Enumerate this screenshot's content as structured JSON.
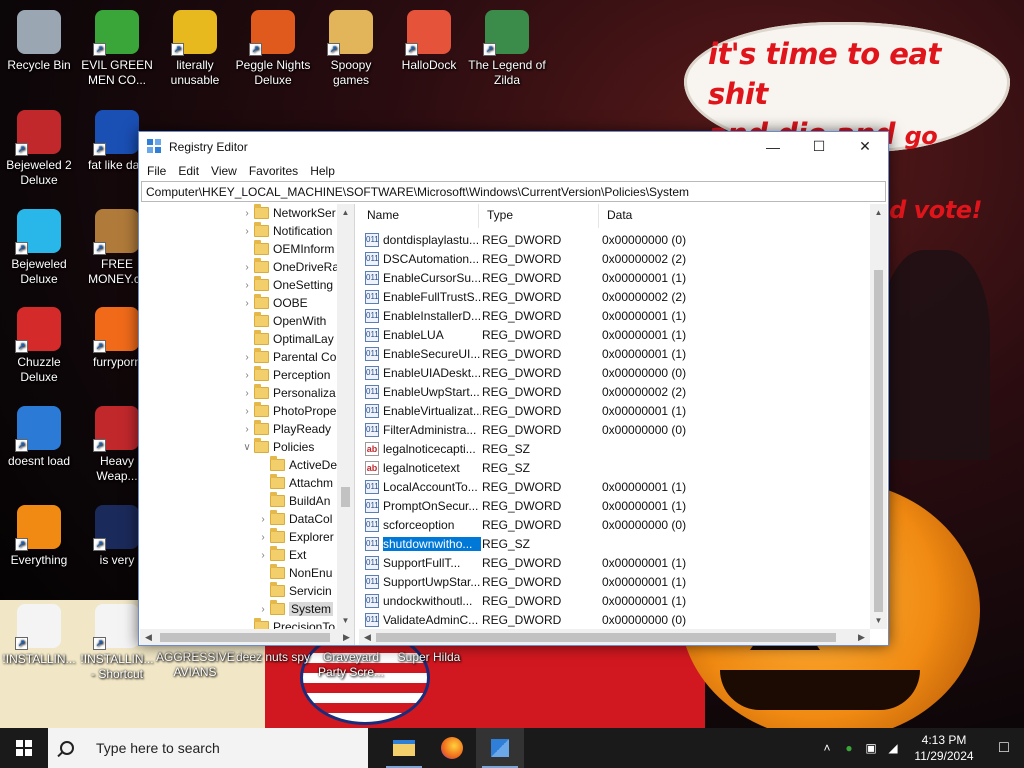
{
  "wallpaper": {
    "speech_line1": "it's time to eat shit",
    "speech_line2a": "and die and",
    "speech_line2b": "go trick",
    "speech_line3": "or treating and vote!"
  },
  "desktop_icons": [
    {
      "label": "Recycle Bin",
      "icon": "recycle-bin-icon",
      "color": "#9aa6b2"
    },
    {
      "label": "EVIL GREEN MEN CO...",
      "icon": "green-people-icon",
      "color": "#3aa63a"
    },
    {
      "label": "literally unusable",
      "icon": "chrome-icon",
      "color": "#e8b81f"
    },
    {
      "label": "Peggle Nights Deluxe",
      "icon": "peggle-icon",
      "color": "#e05a1e"
    },
    {
      "label": "Spoopy games",
      "icon": "folder-icon",
      "color": "#e2b55a"
    },
    {
      "label": "HalloDock",
      "icon": "windows-logo-icon",
      "color": "#e5533a"
    },
    {
      "label": "The Legend of Zilda",
      "icon": "zelda-icon",
      "color": "#3b8c4a"
    },
    {
      "label": "Bejeweled 2 Deluxe",
      "icon": "bejeweled2-icon",
      "color": "#c0282c"
    },
    {
      "label": "fat like darl",
      "icon": "mpl-icon",
      "color": "#1a4fb4"
    },
    {
      "label": "Bejeweled Deluxe",
      "icon": "diamond-icon",
      "color": "#28b7e8"
    },
    {
      "label": "FREE MONEY.cc",
      "icon": "money-bag-icon",
      "color": "#b07a3a"
    },
    {
      "label": "Chuzzle Deluxe",
      "icon": "chuzzle-icon",
      "color": "#d42a2a"
    },
    {
      "label": "furryporn",
      "icon": "firefox-icon",
      "color": "#f06a1a"
    },
    {
      "label": "doesnt load",
      "icon": "thunderbird-icon",
      "color": "#2a7ad6"
    },
    {
      "label": "Heavy Weap...",
      "icon": "radiation-icon",
      "color": "#c0282c"
    },
    {
      "label": "Everything",
      "icon": "everything-search-icon",
      "color": "#f08a12"
    },
    {
      "label": "is very",
      "icon": "shield-logo-icon",
      "color": "#1a2a5a"
    },
    {
      "label": "!INSTALLIN...",
      "icon": "text-file-icon",
      "color": "#f4f4f4"
    },
    {
      "label": "!INSTALLIN... - Shortcut",
      "icon": "text-file-icon",
      "color": "#f4f4f4"
    },
    {
      "label": "AGGRESSIVE AVIANS",
      "icon": "",
      "color": ""
    },
    {
      "label": "deez nuts spy",
      "icon": "",
      "color": ""
    },
    {
      "label": "Graveyard Party Scre...",
      "icon": "",
      "color": ""
    },
    {
      "label": "Super Hilda",
      "icon": "",
      "color": ""
    }
  ],
  "window": {
    "title": "Registry Editor",
    "menu": [
      "File",
      "Edit",
      "View",
      "Favorites",
      "Help"
    ],
    "address": "Computer\\HKEY_LOCAL_MACHINE\\SOFTWARE\\Microsoft\\Windows\\CurrentVersion\\Policies\\System",
    "tree": [
      {
        "label": "NetworkSer",
        "level": 0,
        "expand": ">"
      },
      {
        "label": "Notification",
        "level": 0,
        "expand": ">"
      },
      {
        "label": "OEMInform",
        "level": 0,
        "expand": ""
      },
      {
        "label": "OneDriveRa",
        "level": 0,
        "expand": ">"
      },
      {
        "label": "OneSetting",
        "level": 0,
        "expand": ">"
      },
      {
        "label": "OOBE",
        "level": 0,
        "expand": ">"
      },
      {
        "label": "OpenWith",
        "level": 0,
        "expand": ""
      },
      {
        "label": "OptimalLay",
        "level": 0,
        "expand": ""
      },
      {
        "label": "Parental Co",
        "level": 0,
        "expand": ">"
      },
      {
        "label": "Perception",
        "level": 0,
        "expand": ">"
      },
      {
        "label": "Personaliza",
        "level": 0,
        "expand": ">"
      },
      {
        "label": "PhotoPrope",
        "level": 0,
        "expand": ">"
      },
      {
        "label": "PlayReady",
        "level": 0,
        "expand": ">"
      },
      {
        "label": "Policies",
        "level": 0,
        "expand": "v"
      },
      {
        "label": "ActiveDe",
        "level": 1,
        "expand": ""
      },
      {
        "label": "Attachm",
        "level": 1,
        "expand": ""
      },
      {
        "label": "BuildAn",
        "level": 1,
        "expand": ""
      },
      {
        "label": "DataCol",
        "level": 1,
        "expand": ">"
      },
      {
        "label": "Explorer",
        "level": 1,
        "expand": ">"
      },
      {
        "label": "Ext",
        "level": 1,
        "expand": ">"
      },
      {
        "label": "NonEnu",
        "level": 1,
        "expand": ""
      },
      {
        "label": "Servicin",
        "level": 1,
        "expand": ""
      },
      {
        "label": "System",
        "level": 1,
        "expand": ">",
        "selected": true
      },
      {
        "label": "PrecisionTo",
        "level": 0,
        "expand": ""
      }
    ],
    "columns": {
      "name": "Name",
      "type": "Type",
      "data": "Data"
    },
    "values": [
      {
        "name": "dontdisplaylastu...",
        "type": "REG_DWORD",
        "data": "0x00000000 (0)",
        "kind": "bin"
      },
      {
        "name": "DSCAutomation...",
        "type": "REG_DWORD",
        "data": "0x00000002 (2)",
        "kind": "bin"
      },
      {
        "name": "EnableCursorSu...",
        "type": "REG_DWORD",
        "data": "0x00000001 (1)",
        "kind": "bin"
      },
      {
        "name": "EnableFullTrustS...",
        "type": "REG_DWORD",
        "data": "0x00000002 (2)",
        "kind": "bin"
      },
      {
        "name": "EnableInstallerD...",
        "type": "REG_DWORD",
        "data": "0x00000001 (1)",
        "kind": "bin"
      },
      {
        "name": "EnableLUA",
        "type": "REG_DWORD",
        "data": "0x00000001 (1)",
        "kind": "bin"
      },
      {
        "name": "EnableSecureUI...",
        "type": "REG_DWORD",
        "data": "0x00000001 (1)",
        "kind": "bin"
      },
      {
        "name": "EnableUIADeskt...",
        "type": "REG_DWORD",
        "data": "0x00000000 (0)",
        "kind": "bin"
      },
      {
        "name": "EnableUwpStart...",
        "type": "REG_DWORD",
        "data": "0x00000002 (2)",
        "kind": "bin"
      },
      {
        "name": "EnableVirtualizat...",
        "type": "REG_DWORD",
        "data": "0x00000001 (1)",
        "kind": "bin"
      },
      {
        "name": "FilterAdministra...",
        "type": "REG_DWORD",
        "data": "0x00000000 (0)",
        "kind": "bin"
      },
      {
        "name": "legalnoticecapti...",
        "type": "REG_SZ",
        "data": "",
        "kind": "sz"
      },
      {
        "name": "legalnoticetext",
        "type": "REG_SZ",
        "data": "",
        "kind": "sz"
      },
      {
        "name": "LocalAccountTo...",
        "type": "REG_DWORD",
        "data": "0x00000001 (1)",
        "kind": "bin"
      },
      {
        "name": "PromptOnSecur...",
        "type": "REG_DWORD",
        "data": "0x00000001 (1)",
        "kind": "bin"
      },
      {
        "name": "scforceoption",
        "type": "REG_DWORD",
        "data": "0x00000000 (0)",
        "kind": "bin"
      },
      {
        "name": "shutdownwitho...",
        "type": "REG_SZ",
        "data": "",
        "kind": "bin",
        "selected": true
      },
      {
        "name": "SupportFullT...",
        "type": "REG_DWORD",
        "data": "0x00000001 (1)",
        "kind": "bin"
      },
      {
        "name": "SupportUwpStar...",
        "type": "REG_DWORD",
        "data": "0x00000001 (1)",
        "kind": "bin"
      },
      {
        "name": "undockwithoutl...",
        "type": "REG_DWORD",
        "data": "0x00000001 (1)",
        "kind": "bin"
      },
      {
        "name": "ValidateAdminC...",
        "type": "REG_DWORD",
        "data": "0x00000000 (0)",
        "kind": "bin"
      }
    ]
  },
  "taskbar": {
    "search_placeholder": "Type here to search",
    "apps": [
      "file-explorer-icon",
      "firefox-icon",
      "registry-editor-icon"
    ],
    "time": "4:13 PM",
    "date": "11/29/2024"
  }
}
